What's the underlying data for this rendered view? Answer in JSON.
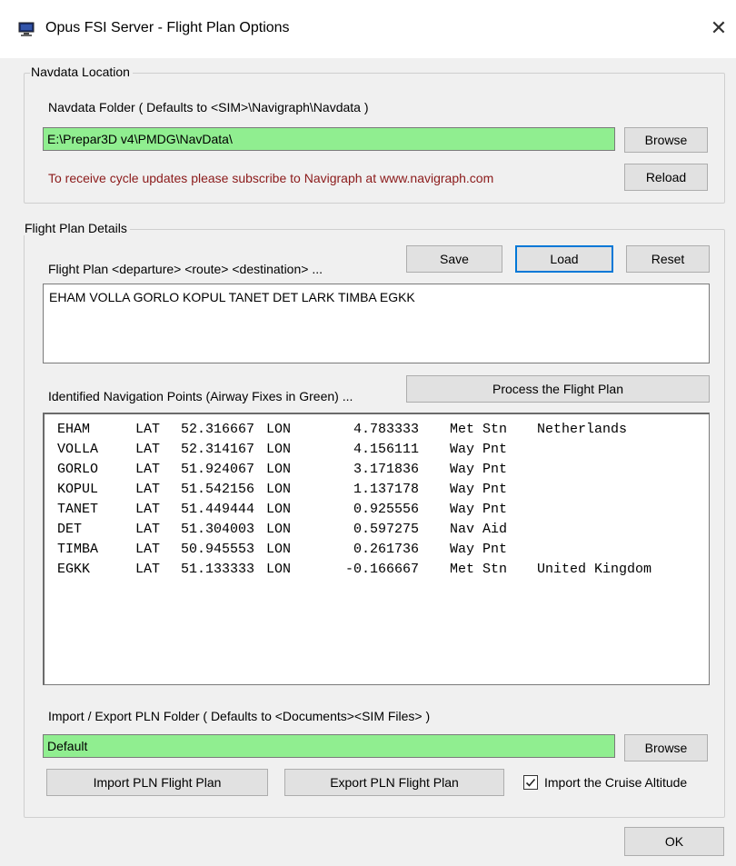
{
  "window": {
    "title": "Opus FSI Server - Flight Plan Options",
    "close_glyph": "✕"
  },
  "navdata": {
    "group_label": "Navdata Location",
    "folder_label": "Navdata Folder ( Defaults to <SIM>\\Navigraph\\Navdata )",
    "folder_value": "E:\\Prepar3D v4\\PMDG\\NavData\\",
    "browse_label": "Browse",
    "subscribe_note": "To receive cycle updates please subscribe to Navigraph at www.navigraph.com",
    "reload_label": "Reload",
    "note_color": "#8b1a1a",
    "field_color": "#90ee90"
  },
  "flightplan": {
    "group_label": "Flight Plan Details",
    "plan_label": "Flight Plan <departure> <route> <destination> ...",
    "save_label": "Save",
    "load_label": "Load",
    "reset_label": "Reset",
    "plan_text": "EHAM VOLLA GORLO KOPUL TANET DET LARK TIMBA EGKK",
    "points_label": "Identified Navigation Points (Airway Fixes in Green) ...",
    "process_label": "Process the Flight Plan",
    "points": [
      {
        "id": "EHAM",
        "lat_tag": "LAT",
        "lat": "52.316667",
        "lon_tag": "LON",
        "lon": "4.783333",
        "type": "Met Stn",
        "country": "Netherlands"
      },
      {
        "id": "VOLLA",
        "lat_tag": "LAT",
        "lat": "52.314167",
        "lon_tag": "LON",
        "lon": "4.156111",
        "type": "Way Pnt",
        "country": ""
      },
      {
        "id": "GORLO",
        "lat_tag": "LAT",
        "lat": "51.924067",
        "lon_tag": "LON",
        "lon": "3.171836",
        "type": "Way Pnt",
        "country": ""
      },
      {
        "id": "KOPUL",
        "lat_tag": "LAT",
        "lat": "51.542156",
        "lon_tag": "LON",
        "lon": "1.137178",
        "type": "Way Pnt",
        "country": ""
      },
      {
        "id": "TANET",
        "lat_tag": "LAT",
        "lat": "51.449444",
        "lon_tag": "LON",
        "lon": "0.925556",
        "type": "Way Pnt",
        "country": ""
      },
      {
        "id": "DET",
        "lat_tag": "LAT",
        "lat": "51.304003",
        "lon_tag": "LON",
        "lon": "0.597275",
        "type": "Nav Aid",
        "country": ""
      },
      {
        "id": "TIMBA",
        "lat_tag": "LAT",
        "lat": "50.945553",
        "lon_tag": "LON",
        "lon": "0.261736",
        "type": "Way Pnt",
        "country": ""
      },
      {
        "id": "EGKK",
        "lat_tag": "LAT",
        "lat": "51.133333",
        "lon_tag": "LON",
        "lon": "-0.166667",
        "type": "Met Stn",
        "country": "United Kingdom"
      }
    ],
    "pln_folder_label": "Import / Export PLN Folder ( Defaults to <Documents><SIM Files> )",
    "pln_folder_value": "Default",
    "pln_browse_label": "Browse",
    "import_label": "Import PLN Flight Plan",
    "export_label": "Export PLN Flight Plan",
    "cruise_checkbox_label": "Import the Cruise Altitude",
    "cruise_checked": true
  },
  "footer": {
    "ok_label": "OK"
  }
}
